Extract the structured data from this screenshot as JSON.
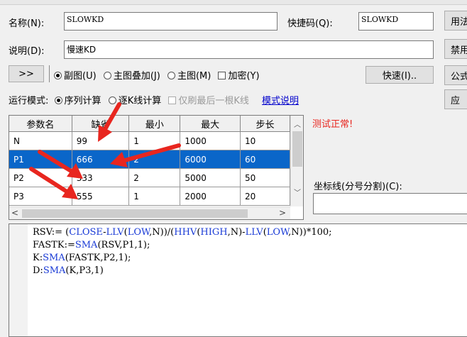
{
  "form": {
    "name_label": "名称(N):",
    "name_value": "SLOWKD",
    "shortcut_label": "快捷码(Q):",
    "shortcut_value": "SLOWKD",
    "desc_label": "说明(D):",
    "desc_value": "慢速KD"
  },
  "right_buttons": [
    "用法",
    "禁用",
    "公式",
    "应"
  ],
  "toolbar": {
    "expand_label": ">>",
    "radio_subchart": "副图(U)",
    "radio_overlay": "主图叠加(J)",
    "radio_main": "主图(M)",
    "encrypt_label": "加密(Y)",
    "quick_label": "快速(I).."
  },
  "run_mode": {
    "label": "运行模式:",
    "radio_sequence": "序列计算",
    "radio_per_bar": "逐K线计算",
    "last_bar_label": "仅刷最后一根K线",
    "help_link": "模式说明"
  },
  "params_table": {
    "headers": [
      "参数名",
      "缺省",
      "最小",
      "最大",
      "步长"
    ],
    "rows": [
      [
        "N",
        "99",
        "1",
        "1000",
        "10"
      ],
      [
        "P1",
        "666",
        "2",
        "6000",
        "60"
      ],
      [
        "P2",
        "333",
        "2",
        "5000",
        "50"
      ],
      [
        "P3",
        "555",
        "1",
        "2000",
        "20"
      ]
    ],
    "selected_row": 1
  },
  "status": {
    "text": "测试正常!",
    "color": "#e8261f"
  },
  "coord_label": "坐标线(分号分割)(C):",
  "code_lines": [
    [
      [
        "",
        "RSV:= ("
      ],
      [
        "fn",
        "CLOSE"
      ],
      [
        "",
        "-"
      ],
      [
        "fn",
        "LLV"
      ],
      [
        "",
        "("
      ],
      [
        "fn",
        "LOW"
      ],
      [
        "",
        ",N))/("
      ],
      [
        "fn",
        "HHV"
      ],
      [
        "",
        "("
      ],
      [
        "fn",
        "HIGH"
      ],
      [
        "",
        ",N)-"
      ],
      [
        "fn",
        "LLV"
      ],
      [
        "",
        "("
      ],
      [
        "fn",
        "LOW"
      ],
      [
        "",
        ",N))*100;"
      ]
    ],
    [
      [
        "",
        "FASTK:="
      ],
      [
        "fn",
        "SMA"
      ],
      [
        "",
        "(RSV,P1,1);"
      ]
    ],
    [
      [
        "",
        "K:"
      ],
      [
        "fn",
        "SMA"
      ],
      [
        "",
        "(FASTK,P2,1);"
      ]
    ],
    [
      [
        "",
        "D:"
      ],
      [
        "fn",
        "SMA"
      ],
      [
        "",
        "(K,P3,1)"
      ]
    ]
  ],
  "colors": {
    "selection": "#0a66c9",
    "keyword": "#1a3bd6",
    "annotation_arrow": "#e8261f"
  }
}
